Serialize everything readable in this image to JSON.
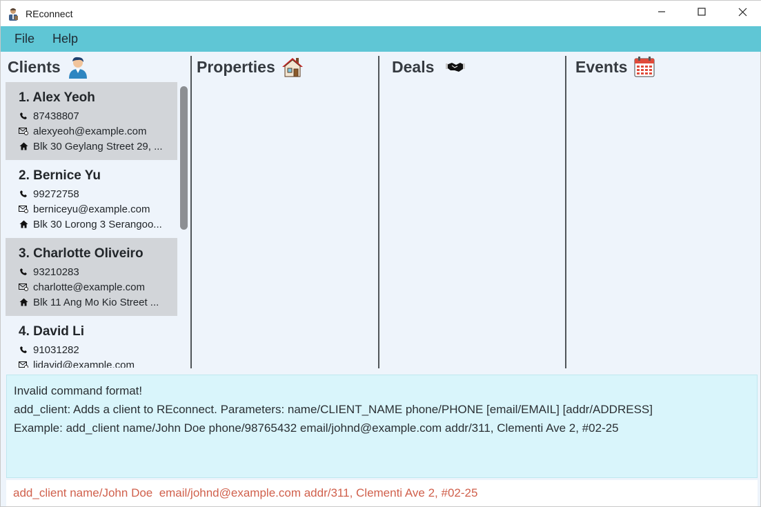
{
  "window": {
    "title": "REconnect",
    "icon": "agent-person-icon",
    "controls": {
      "minimize": "—",
      "maximize": "☐",
      "close": "✕"
    }
  },
  "menu": {
    "items": [
      {
        "label": "File"
      },
      {
        "label": "Help"
      }
    ]
  },
  "panels": {
    "clients": {
      "title": "Clients",
      "icon": "person-icon"
    },
    "properties": {
      "title": "Properties",
      "icon": "house-icon"
    },
    "deals": {
      "title": "Deals",
      "icon": "handshake-icon"
    },
    "events": {
      "title": "Events",
      "icon": "calendar-icon"
    }
  },
  "clients": [
    {
      "name": "1. Alex Yeoh",
      "phone": "87438807",
      "email": "alexyeoh@example.com",
      "address": "Blk 30 Geylang Street 29, ..."
    },
    {
      "name": "2. Bernice Yu",
      "phone": "99272758",
      "email": "berniceyu@example.com",
      "address": "Blk 30 Lorong 3 Serangoo..."
    },
    {
      "name": "3. Charlotte Oliveiro",
      "phone": "93210283",
      "email": "charlotte@example.com",
      "address": "Blk 11 Ang Mo Kio Street ..."
    },
    {
      "name": "4. David Li",
      "phone": "91031282",
      "email": "lidavid@example.com",
      "address": ""
    }
  ],
  "result": {
    "lines": [
      "Invalid command format!",
      "add_client: Adds a client to REconnect. Parameters: name/CLIENT_NAME phone/PHONE [email/EMAIL] [addr/ADDRESS]",
      "Example: add_client name/John Doe phone/98765432 email/johnd@example.com addr/311, Clementi Ave 2, #02-25"
    ]
  },
  "command": {
    "value": "add_client name/John Doe  email/johnd@example.com addr/311, Clementi Ave 2, #02-25"
  },
  "colors": {
    "menubar": "#5fc6d5",
    "result_bg": "#d9f5fb",
    "command_error_text": "#d0604c",
    "selected_card": "#d2d5d9"
  }
}
